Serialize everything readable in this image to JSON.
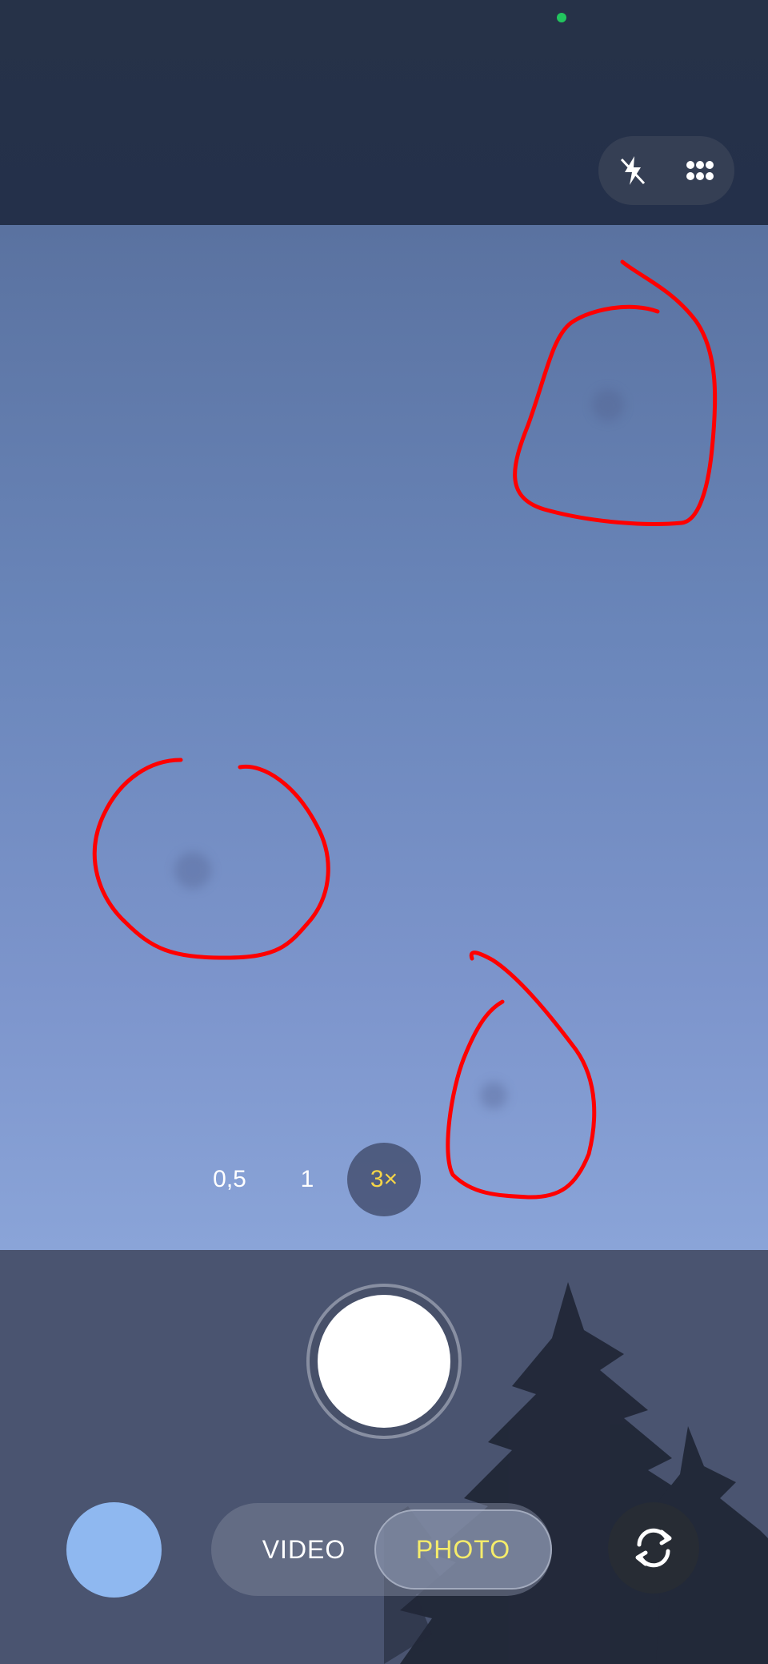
{
  "top_bar": {
    "icons": [
      "flash-off-icon",
      "more-options-icon"
    ]
  },
  "zoom": {
    "options": [
      "0,5",
      "1",
      "3×"
    ],
    "selected": "3×"
  },
  "modes": {
    "video_label": "VIDEO",
    "photo_label": "PHOTO",
    "selected": "PHOTO"
  },
  "colors": {
    "accent_yellow": "#f5d547",
    "annotation_red": "#ff0000",
    "status_dot": "#22c55e"
  }
}
